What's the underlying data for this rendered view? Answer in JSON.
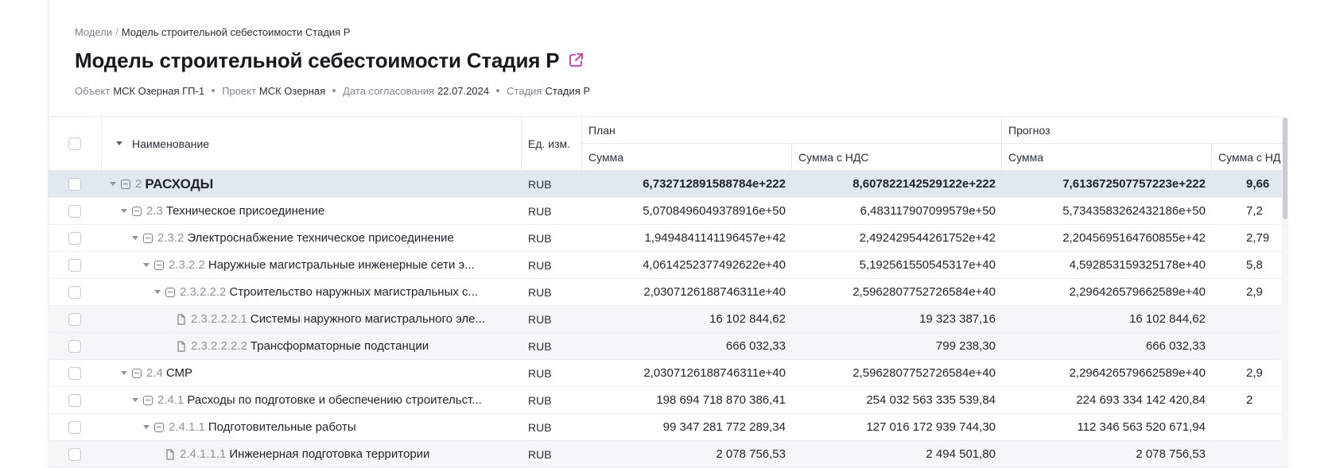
{
  "breadcrumb": {
    "root": "Модели",
    "separator": "/",
    "current": "Модель строительной себестоимости Стадия Р"
  },
  "page_title": "Модель строительной себестоимости Стадия Р",
  "meta": {
    "object_label": "Объект",
    "object_value": "МСК Озерная ГП-1",
    "project_label": "Проект",
    "project_value": "МСК Озерная",
    "date_label": "Дата согласования",
    "date_value": "22.07.2024",
    "stage_label": "Стадия",
    "stage_value": "Стадия Р"
  },
  "accent_color": "#c23aa8",
  "table": {
    "headers": {
      "name": "Наименование",
      "unit": "Ед. изм.",
      "plan": "План",
      "forecast": "Прогноз",
      "plan_sum": "Сумма",
      "plan_sum_vat": "Сумма с НДС",
      "forecast_sum": "Сумма",
      "forecast_sum_vat": "Сумма с НД"
    },
    "rows": [
      {
        "level": 0,
        "type": "group",
        "code": "2",
        "name": "РАСХОДЫ",
        "unit": "RUB",
        "plan_sum": "6,732712891588784e+222",
        "plan_sum_vat": "8,607822142529122e+222",
        "forecast_sum": "7,613672507757223e+222",
        "forecast_sum_vat": "9,66",
        "selected": true,
        "bold": true
      },
      {
        "level": 1,
        "type": "group",
        "code": "2.3",
        "name": "Техническое присоединение",
        "unit": "RUB",
        "plan_sum": "5,0708496049378916e+50",
        "plan_sum_vat": "6,483117907099579e+50",
        "forecast_sum": "5,7343583262432186e+50",
        "forecast_sum_vat": "7,2"
      },
      {
        "level": 2,
        "type": "group",
        "code": "2.3.2",
        "name": "Электроснабжение техническое присоединение",
        "unit": "RUB",
        "plan_sum": "1,9494841141196457e+42",
        "plan_sum_vat": "2,492429544261752e+42",
        "forecast_sum": "2,2045695164760855e+42",
        "forecast_sum_vat": "2,79"
      },
      {
        "level": 3,
        "type": "group",
        "code": "2.3.2.2",
        "name": "Наружные магистральные инженерные сети э...",
        "unit": "RUB",
        "plan_sum": "4,0614252377492622e+40",
        "plan_sum_vat": "5,192561550545317e+40",
        "forecast_sum": "4,592853159325178e+40",
        "forecast_sum_vat": "5,8"
      },
      {
        "level": 4,
        "type": "group",
        "code": "2.3.2.2.2",
        "name": "Строительство наружных магистральных с...",
        "unit": "RUB",
        "plan_sum": "2,0307126188746311e+40",
        "plan_sum_vat": "2,5962807752726584e+40",
        "forecast_sum": "2,296426579662589e+40",
        "forecast_sum_vat": "2,9"
      },
      {
        "level": 5,
        "type": "leaf",
        "code": "2.3.2.2.2.1",
        "name": "Системы наружного магистрального эле...",
        "unit": "RUB",
        "plan_sum": "16 102 844,62",
        "plan_sum_vat": "19 323 387,16",
        "forecast_sum": "16 102 844,62",
        "forecast_sum_vat": ""
      },
      {
        "level": 5,
        "type": "leaf",
        "code": "2.3.2.2.2.2",
        "name": "Трансформаторные подстанции",
        "unit": "RUB",
        "plan_sum": "666 032,33",
        "plan_sum_vat": "799 238,30",
        "forecast_sum": "666 032,33",
        "forecast_sum_vat": ""
      },
      {
        "level": 1,
        "type": "group",
        "code": "2.4",
        "name": "СМР",
        "unit": "RUB",
        "plan_sum": "2,0307126188746311e+40",
        "plan_sum_vat": "2,5962807752726584e+40",
        "forecast_sum": "2,296426579662589e+40",
        "forecast_sum_vat": "2,9"
      },
      {
        "level": 2,
        "type": "group",
        "code": "2.4.1",
        "name": "Расходы по подготовке и обеспечению строительст...",
        "unit": "RUB",
        "plan_sum": "198 694 718 870 386,41",
        "plan_sum_vat": "254 032 563 335 539,84",
        "forecast_sum": "224 693 334 142 420,84",
        "forecast_sum_vat": "2"
      },
      {
        "level": 3,
        "type": "group",
        "code": "2.4.1.1",
        "name": "Подготовительные работы",
        "unit": "RUB",
        "plan_sum": "99 347 281 772 289,34",
        "plan_sum_vat": "127 016 172 939 744,30",
        "forecast_sum": "112 346 563 520 671,94",
        "forecast_sum_vat": ""
      },
      {
        "level": 4,
        "type": "leaf",
        "code": "2.4.1.1.1",
        "name": "Инженерная подготовка территории",
        "unit": "RUB",
        "plan_sum": "2 078 756,53",
        "plan_sum_vat": "2 494 501,80",
        "forecast_sum": "2 078 756,53",
        "forecast_sum_vat": ""
      }
    ]
  }
}
